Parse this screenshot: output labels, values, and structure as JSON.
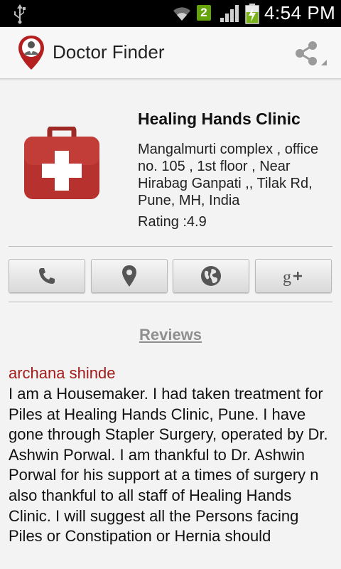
{
  "status_bar": {
    "time": "4:54 PM",
    "notification_count": "2",
    "icons": [
      "usb-icon",
      "wifi-icon",
      "signal-icon",
      "battery-charging-icon"
    ]
  },
  "app": {
    "title": "Doctor Finder",
    "icons": [
      "doctor-pin-icon",
      "share-icon"
    ]
  },
  "clinic": {
    "name": "Healing Hands Clinic",
    "address": "Mangalmurti complex , office no. 105 , 1st floor , Near Hirabag Ganpati ,, Tilak Rd, Pune, MH, India",
    "rating": "Rating :4.9",
    "logo_icon": "first-aid-kit-icon",
    "logo_color": "#b7322f"
  },
  "actions": [
    {
      "name": "call",
      "icon": "phone-icon"
    },
    {
      "name": "map",
      "icon": "location-pin-icon"
    },
    {
      "name": "website",
      "icon": "globe-icon"
    },
    {
      "name": "google-plus",
      "icon": "google-plus-icon"
    }
  ],
  "reviews": {
    "title": "Reviews",
    "items": [
      {
        "author": "archana shinde",
        "text": "I am a Housemaker. I had taken treatment for Piles at Healing Hands Clinic, Pune. I have gone through Stapler Surgery, operated by Dr. Ashwin Porwal. I am thankful to Dr. Ashwin Porwal for his support at a times of surgery n also thankful to all staff of Healing Hands Clinic. I will suggest all the Persons facing Piles or Constipation or Hernia should"
      }
    ]
  },
  "colors": {
    "status_bar_bg": "#000000",
    "action_bar_bg": "#f7f7f7",
    "page_bg": "#f3f3f3",
    "reviewer_color": "#a51c1c",
    "reviews_title_color": "#8f8f8f"
  }
}
